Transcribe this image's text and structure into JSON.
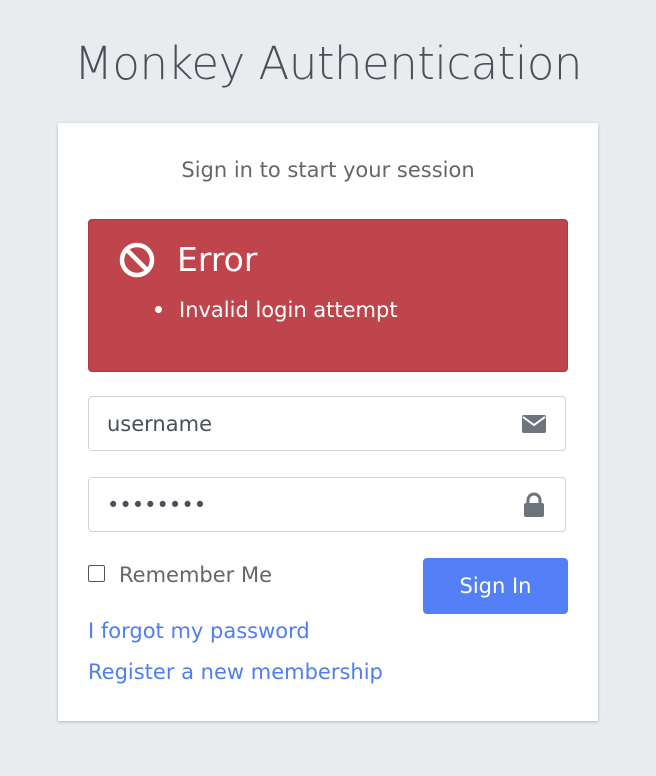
{
  "app": {
    "title": "Monkey Authentication"
  },
  "login": {
    "session_message": "Sign in to start your session",
    "error": {
      "title": "Error",
      "icon": "ban-icon",
      "messages": [
        "Invalid login attempt"
      ]
    },
    "username": {
      "value": "username",
      "placeholder": "username",
      "icon": "envelope-icon"
    },
    "password": {
      "value": "password",
      "placeholder": "password",
      "icon": "lock-icon"
    },
    "remember_label": "Remember Me",
    "sign_in_label": "Sign In",
    "forgot_link": "I forgot my password",
    "register_link": "Register a new membership"
  },
  "colors": {
    "background": "#e9ecef",
    "error": "#bf444b",
    "primary": "#5380f7",
    "link": "#4e7ef0"
  }
}
